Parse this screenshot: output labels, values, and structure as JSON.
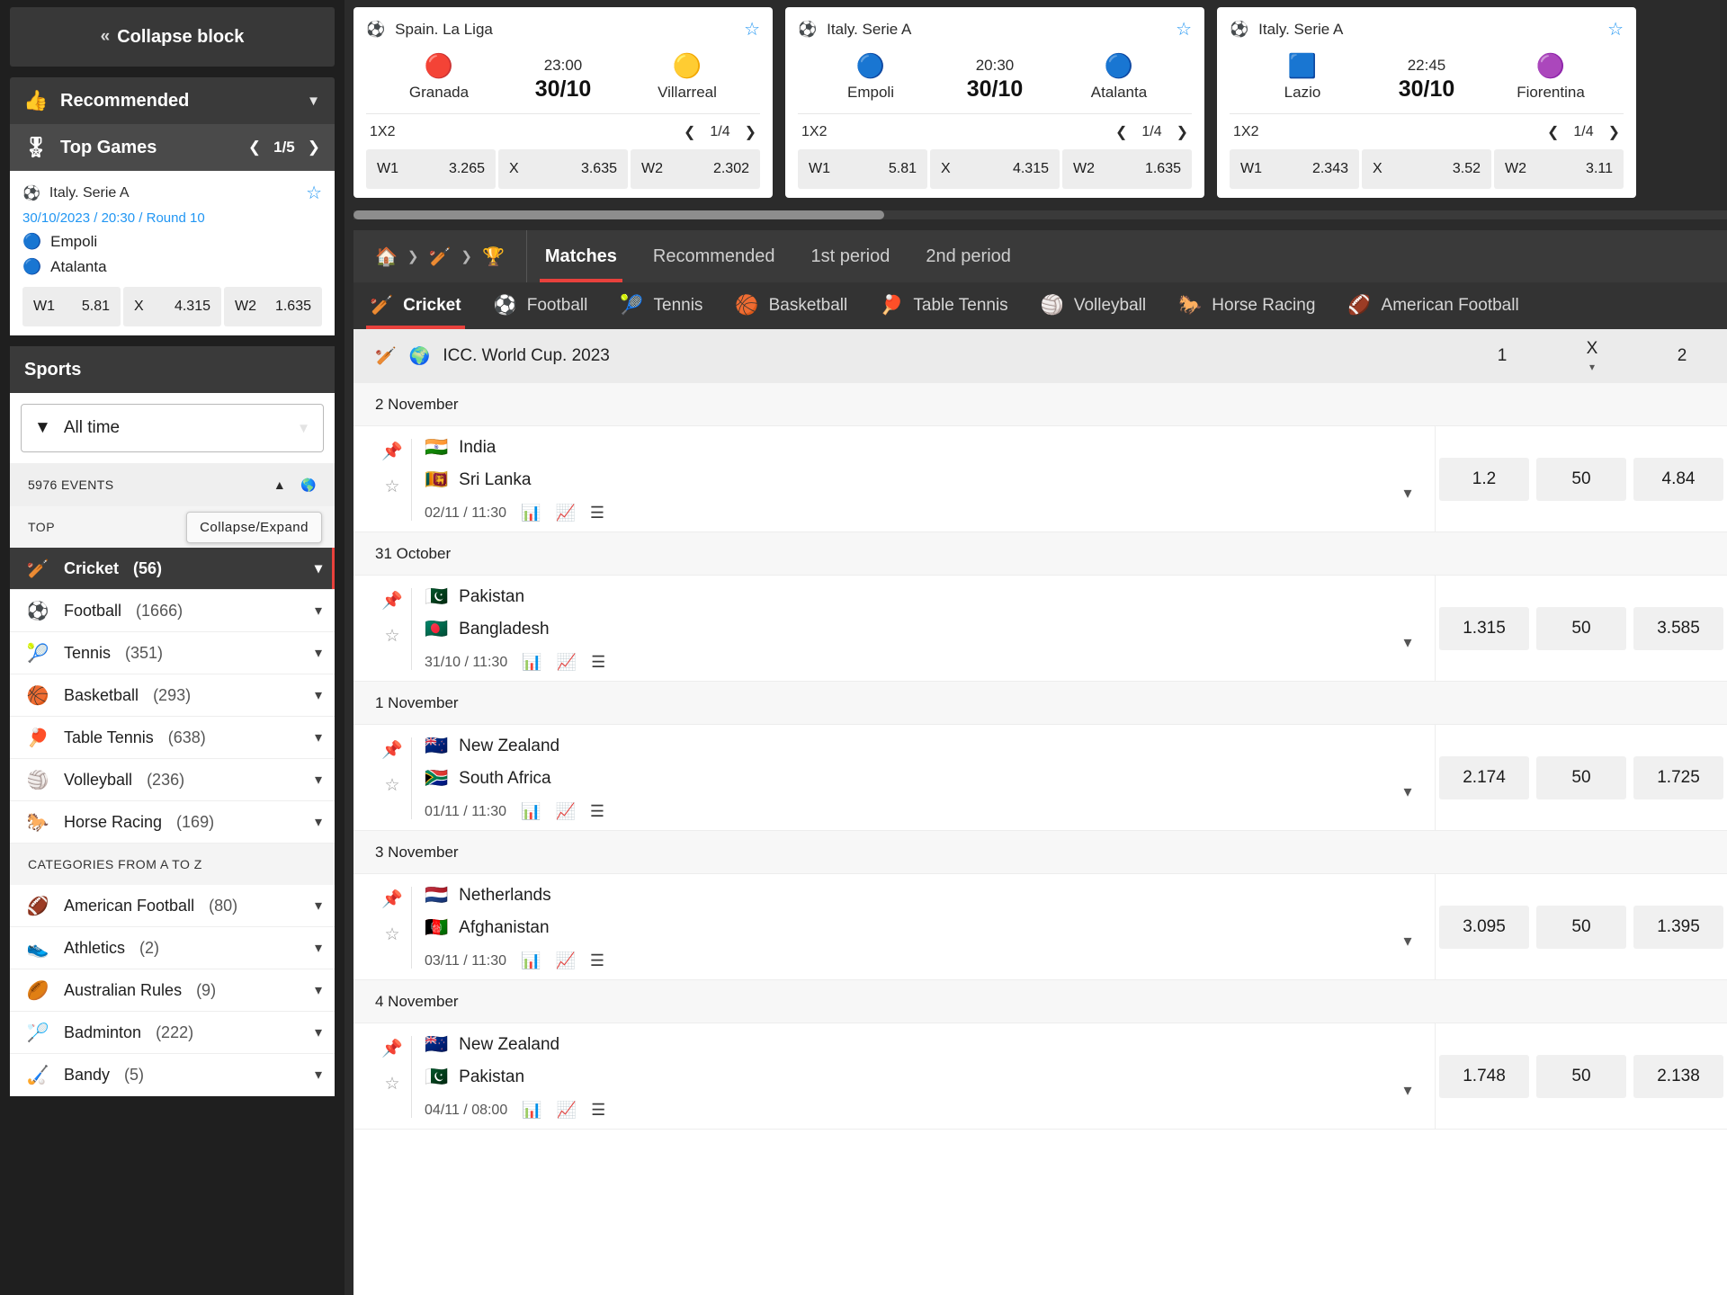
{
  "sidebar": {
    "collapse_label": "Collapse block",
    "recommended_label": "Recommended",
    "top_games": {
      "title": "Top Games",
      "page": "1/5",
      "card": {
        "league": "Italy. Serie A",
        "meta": "30/10/2023 / 20:30 / Round 10",
        "team1": "Empoli",
        "team2": "Atalanta",
        "odds": [
          {
            "k": "W1",
            "v": "5.81"
          },
          {
            "k": "X",
            "v": "4.315"
          },
          {
            "k": "W2",
            "v": "1.635"
          }
        ]
      }
    },
    "sports_title": "Sports",
    "filter_value": "All time",
    "events_count": "5976 EVENTS",
    "top_label": "TOP",
    "tooltip": "Collapse/Expand",
    "az_label": "CATEGORIES FROM A TO Z",
    "top_items": [
      {
        "icon": "cricket-icon",
        "glyph": "🏏",
        "label": "Cricket",
        "count": "(56)",
        "active": true
      },
      {
        "icon": "football-icon",
        "glyph": "⚽",
        "label": "Football",
        "count": "(1666)",
        "active": false
      },
      {
        "icon": "tennis-icon",
        "glyph": "🎾",
        "label": "Tennis",
        "count": "(351)",
        "active": false
      },
      {
        "icon": "basketball-icon",
        "glyph": "🏀",
        "label": "Basketball",
        "count": "(293)",
        "active": false
      },
      {
        "icon": "table-tennis-icon",
        "glyph": "🏓",
        "label": "Table Tennis",
        "count": "(638)",
        "active": false
      },
      {
        "icon": "volleyball-icon",
        "glyph": "🏐",
        "label": "Volleyball",
        "count": "(236)",
        "active": false
      },
      {
        "icon": "horse-racing-icon",
        "glyph": "🐎",
        "label": "Horse Racing",
        "count": "(169)",
        "active": false
      }
    ],
    "az_items": [
      {
        "icon": "american-football-icon",
        "glyph": "🏈",
        "label": "American Football",
        "count": "(80)"
      },
      {
        "icon": "athletics-icon",
        "glyph": "👟",
        "label": "Athletics",
        "count": "(2)"
      },
      {
        "icon": "australian-rules-icon",
        "glyph": "🏉",
        "label": "Australian Rules",
        "count": "(9)"
      },
      {
        "icon": "badminton-icon",
        "glyph": "🏸",
        "label": "Badminton",
        "count": "(222)"
      },
      {
        "icon": "bandy-icon",
        "glyph": "🏑",
        "label": "Bandy",
        "count": "(5)"
      }
    ]
  },
  "top_cards": [
    {
      "league": "Spain. La Liga",
      "league_icon": "football-icon",
      "team1": "Granada",
      "team1_crest": "🔴",
      "team2": "Villarreal",
      "team2_crest": "🟡",
      "time": "23:00",
      "date": "30/10",
      "market": "1X2",
      "page": "1/4",
      "odds": [
        {
          "k": "W1",
          "v": "3.265"
        },
        {
          "k": "X",
          "v": "3.635"
        },
        {
          "k": "W2",
          "v": "2.302"
        }
      ]
    },
    {
      "league": "Italy. Serie A",
      "league_icon": "football-icon",
      "team1": "Empoli",
      "team1_crest": "🔵",
      "team2": "Atalanta",
      "team2_crest": "🔵",
      "time": "20:30",
      "date": "30/10",
      "market": "1X2",
      "page": "1/4",
      "odds": [
        {
          "k": "W1",
          "v": "5.81"
        },
        {
          "k": "X",
          "v": "4.315"
        },
        {
          "k": "W2",
          "v": "1.635"
        }
      ]
    },
    {
      "league": "Italy. Serie A",
      "league_icon": "football-icon",
      "team1": "Lazio",
      "team1_crest": "🟦",
      "team2": "Fiorentina",
      "team2_crest": "🟣",
      "time": "22:45",
      "date": "30/10",
      "market": "1X2",
      "page": "1/4",
      "odds": [
        {
          "k": "W1",
          "v": "2.343"
        },
        {
          "k": "X",
          "v": "3.52"
        },
        {
          "k": "W2",
          "v": "3.11"
        }
      ]
    }
  ],
  "navbar": {
    "breadcrumb": [
      "home-icon",
      "cricket-icon",
      "trophy-icon"
    ],
    "tabs": [
      {
        "label": "Matches",
        "active": true
      },
      {
        "label": "Recommended",
        "active": false
      },
      {
        "label": "1st period",
        "active": false
      },
      {
        "label": "2nd period",
        "active": false
      }
    ]
  },
  "sport_tabs": [
    {
      "glyph": "🏏",
      "icon": "cricket-icon",
      "label": "Cricket",
      "active": true
    },
    {
      "glyph": "⚽",
      "icon": "football-icon",
      "label": "Football",
      "active": false
    },
    {
      "glyph": "🎾",
      "icon": "tennis-icon",
      "label": "Tennis",
      "active": false
    },
    {
      "glyph": "🏀",
      "icon": "basketball-icon",
      "label": "Basketball",
      "active": false
    },
    {
      "glyph": "🏓",
      "icon": "table-tennis-icon",
      "label": "Table Tennis",
      "active": false
    },
    {
      "glyph": "🏐",
      "icon": "volleyball-icon",
      "label": "Volleyball",
      "active": false
    },
    {
      "glyph": "🐎",
      "icon": "horse-racing-icon",
      "label": "Horse Racing",
      "active": false
    },
    {
      "glyph": "🏈",
      "icon": "american-football-icon",
      "label": "American Football",
      "active": false
    }
  ],
  "league": {
    "sport_icon": "cricket-icon",
    "globe": "🌍",
    "name": "ICC. World Cup. 2023",
    "columns": [
      "1",
      "X",
      "2"
    ]
  },
  "groups": [
    {
      "date": "2 November",
      "matches": [
        {
          "team1": "India",
          "flag1": "🇮🇳",
          "team2": "Sri Lanka",
          "flag2": "🇱🇰",
          "meta": "02/11 / 11:30",
          "odds": [
            "1.2",
            "50",
            "4.84"
          ]
        }
      ]
    },
    {
      "date": "31 October",
      "matches": [
        {
          "team1": "Pakistan",
          "flag1": "🇵🇰",
          "team2": "Bangladesh",
          "flag2": "🇧🇩",
          "meta": "31/10 / 11:30",
          "odds": [
            "1.315",
            "50",
            "3.585"
          ]
        }
      ]
    },
    {
      "date": "1 November",
      "matches": [
        {
          "team1": "New Zealand",
          "flag1": "🇳🇿",
          "team2": "South Africa",
          "flag2": "🇿🇦",
          "meta": "01/11 / 11:30",
          "odds": [
            "2.174",
            "50",
            "1.725"
          ]
        }
      ]
    },
    {
      "date": "3 November",
      "matches": [
        {
          "team1": "Netherlands",
          "flag1": "🇳🇱",
          "team2": "Afghanistan",
          "flag2": "🇦🇫",
          "meta": "03/11 / 11:30",
          "odds": [
            "3.095",
            "50",
            "1.395"
          ]
        }
      ]
    },
    {
      "date": "4 November",
      "matches": [
        {
          "team1": "New Zealand",
          "flag1": "🇳🇿",
          "team2": "Pakistan",
          "flag2": "🇵🇰",
          "meta": "04/11 / 08:00",
          "odds": [
            "1.748",
            "50",
            "2.138"
          ]
        }
      ]
    }
  ],
  "colors": {
    "accent": "#e8413c",
    "link": "#2196f3",
    "dark": "#2b2b2b"
  }
}
